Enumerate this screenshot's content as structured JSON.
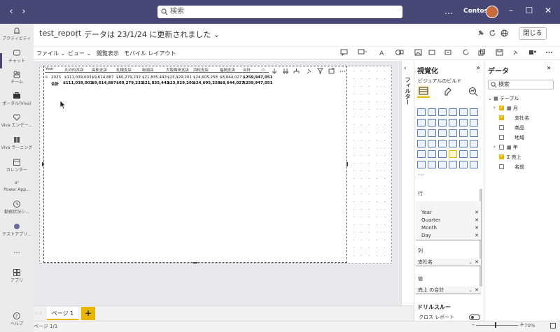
{
  "titlebar": {
    "search_placeholder": "検索",
    "tenant": "Contoso",
    "more": "…",
    "back": "‹",
    "forward": "›"
  },
  "rail": {
    "items": [
      {
        "label": "アクティビティ",
        "icon": "bell-icon"
      },
      {
        "label": "チャット",
        "icon": "chat-icon"
      },
      {
        "label": "チーム",
        "icon": "teams-icon"
      },
      {
        "label": "ポータル(Viva)",
        "icon": "briefcase-icon"
      },
      {
        "label": "Viva エンゲー...",
        "icon": "heart-icon"
      },
      {
        "label": "Viva ラーニング",
        "icon": "book-icon"
      },
      {
        "label": "カレンダー",
        "icon": "calendar-icon"
      },
      {
        "label": "Power App...",
        "icon": "powerapps-icon"
      },
      {
        "label": "勤務状況シ...",
        "icon": "clock-icon"
      },
      {
        "label": "テストアプリ...",
        "icon": "app-icon"
      },
      {
        "label": "...",
        "icon": "more-icon"
      },
      {
        "label": "アプリ",
        "icon": "apps-icon"
      },
      {
        "label": "ヘルプ",
        "icon": "help-icon"
      }
    ]
  },
  "header": {
    "report_name": "test_report",
    "separator": "|",
    "status": "データは 23/1/24 に更新されました",
    "close_label": "閉じる"
  },
  "ribbon": {
    "file": "ファイル",
    "view": "ビュー",
    "reading_view": "閲覧表示",
    "mobile_layout": "モバイル レイアウト"
  },
  "table": {
    "columns": [
      "Year",
      "丸の内本店",
      "高松支店",
      "札幌支店",
      "新潟店",
      "大阪梅田支店",
      "浜松支店",
      "福岡支店",
      "合計"
    ],
    "rows": [
      {
        "label": "2023",
        "values": [
          "$111,039,003",
          "$9,614,887",
          "$60,279,232",
          "$21,835,443",
          "$23,929,201",
          "$24,605,258",
          "$8,644,027",
          "$259,947,051"
        ]
      },
      {
        "label": "合計",
        "values": [
          "$111,039,003",
          "$9,614,887",
          "$60,279,232",
          "$21,835,443",
          "$23,929,201",
          "$24,605,258",
          "$8,644,027",
          "$259,947,051"
        ]
      }
    ]
  },
  "tabs": {
    "page1": "ページ 1",
    "add": "+"
  },
  "status": {
    "page_count": "ページ 1/1",
    "zoom": "70%"
  },
  "filter_pane": {
    "label": "フィルター"
  },
  "viz_pane": {
    "title": "視覚化",
    "subtitle": "ビジュアルのビルド",
    "more": "···",
    "rows_label": "行",
    "rows_field": "月",
    "rows_sub": [
      "Year",
      "Quarter",
      "Month",
      "Day"
    ],
    "cols_label": "列",
    "cols_field": "支社名",
    "values_label": "値",
    "values_field": "売上 の合計",
    "drill_label": "ドリルスルー",
    "cross_report": "クロス レポート"
  },
  "data_pane": {
    "title": "データ",
    "search_placeholder": "検索",
    "table_name": "テーブル",
    "fields": [
      {
        "name": "月",
        "checked": true,
        "expandable": true
      },
      {
        "name": "支社名",
        "checked": true,
        "expandable": false
      },
      {
        "name": "商品",
        "checked": false,
        "expandable": false
      },
      {
        "name": "地域",
        "checked": false,
        "expandable": false
      },
      {
        "name": "年",
        "checked": false,
        "expandable": true
      },
      {
        "name": "売上",
        "checked": true,
        "expandable": false
      },
      {
        "name": "名前",
        "checked": false,
        "expandable": false
      }
    ]
  },
  "colors": {
    "titlebar": "#464775",
    "accent": "#e8b500"
  }
}
